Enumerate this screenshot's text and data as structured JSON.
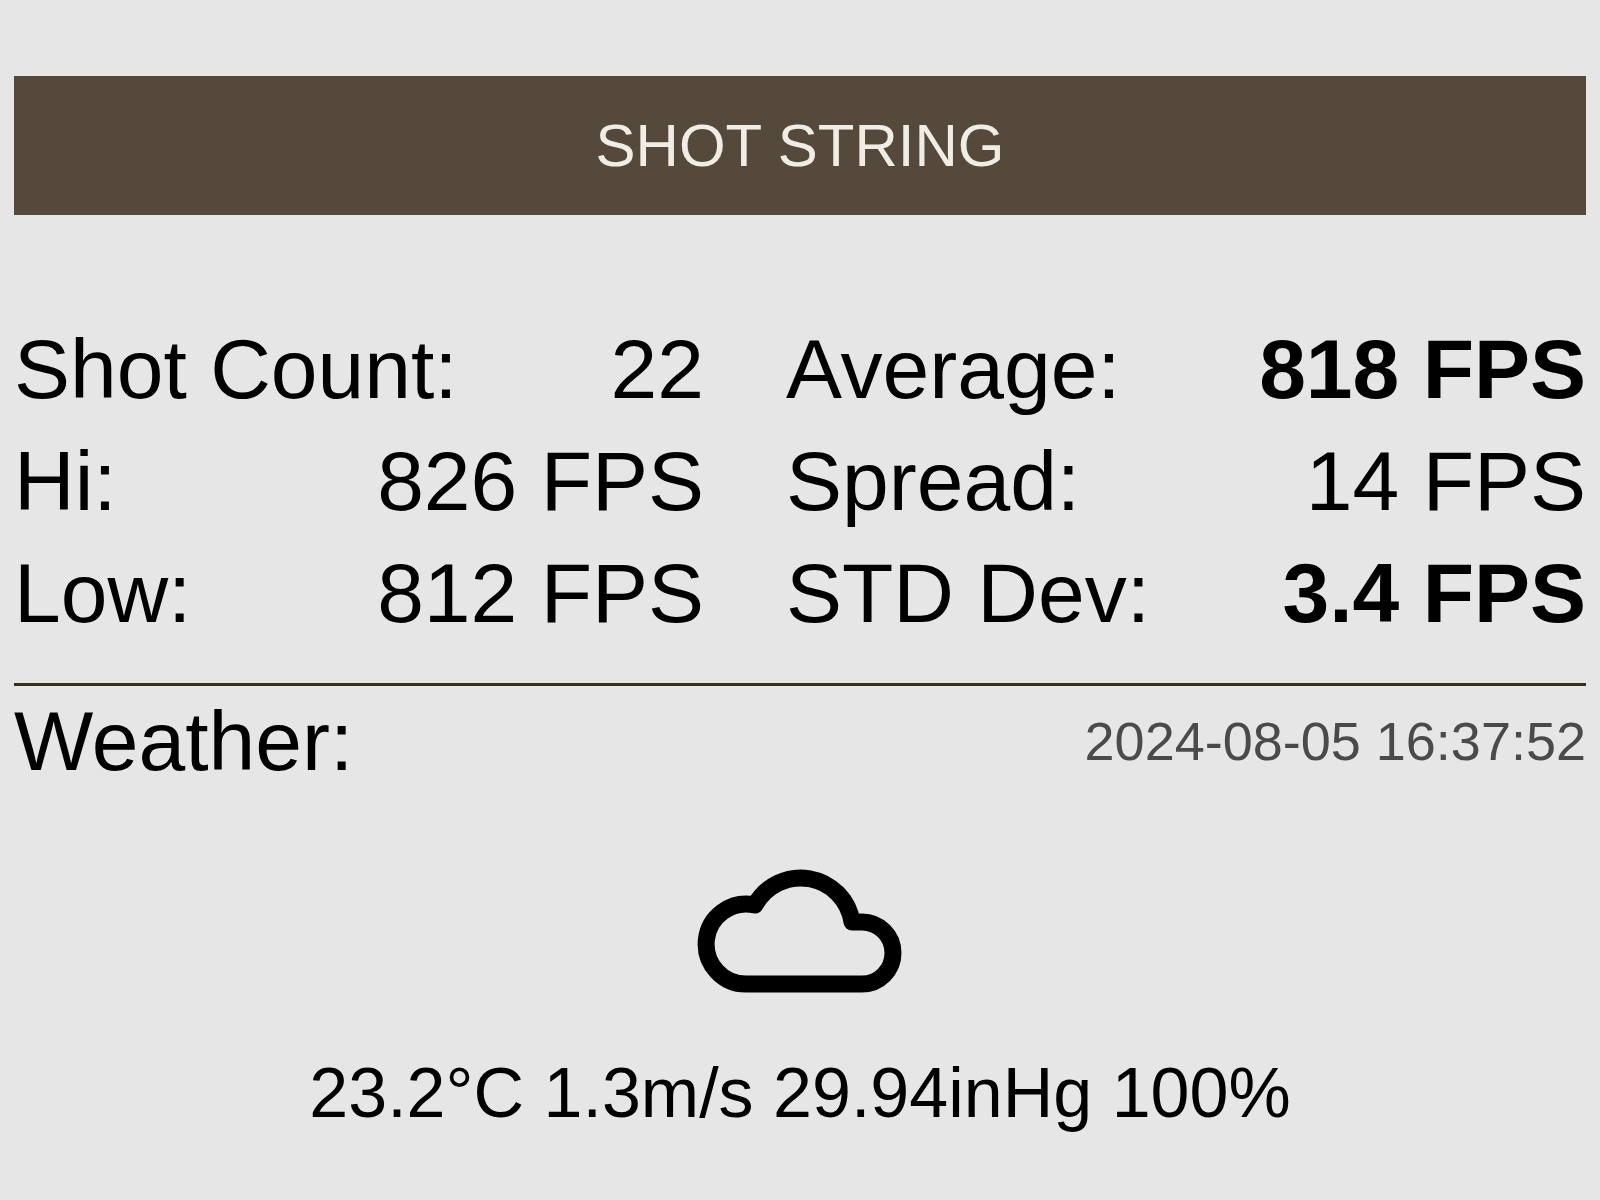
{
  "header": {
    "title": "SHOT STRING"
  },
  "stats": [
    {
      "label": "Shot Count:",
      "value": "22",
      "bold": false
    },
    {
      "label": "Average:",
      "value": "818 FPS",
      "bold": true
    },
    {
      "label": "Hi:",
      "value": "826 FPS",
      "bold": false
    },
    {
      "label": "Spread:",
      "value": "14 FPS",
      "bold": false
    },
    {
      "label": "Low:",
      "value": "812 FPS",
      "bold": false
    },
    {
      "label": "STD Dev:",
      "value": "3.4 FPS",
      "bold": true
    }
  ],
  "weather": {
    "label": "Weather:",
    "timestamp": "2024-08-05 16:37:52",
    "readings": "23.2°C 1.3m/s 29.94inHg 100%"
  }
}
